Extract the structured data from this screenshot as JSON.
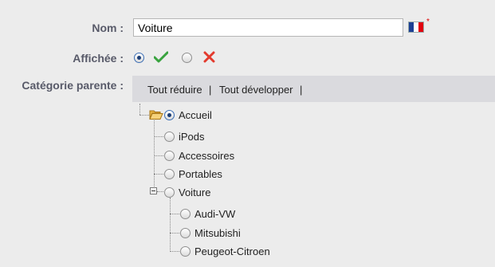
{
  "form": {
    "name_label": "Nom :",
    "name_value": "Voiture",
    "required_mark": "*",
    "displayed_label": "Affichée :",
    "displayed_selected": "yes",
    "parent_category_label": "Catégorie parente :"
  },
  "flag": {
    "colors": [
      "#1c3f94",
      "#ffffff",
      "#e1000f"
    ]
  },
  "icons": {
    "yes": "check-icon",
    "no": "cross-icon",
    "root": "open-folder-icon",
    "collapse": "minus-icon"
  },
  "colors": {
    "check": "#39a33f",
    "cross": "#e33b2e",
    "toolbar_bg": "#dadade",
    "page_bg": "#ececec"
  },
  "tree": {
    "collapse_all": "Tout réduire",
    "expand_all": "Tout développer",
    "separator": "|",
    "root": {
      "label": "Accueil",
      "selected": true
    },
    "children": [
      "iPods",
      "Accessoires",
      "Portables",
      "Voiture"
    ],
    "voiture_children": [
      "Audi-VW",
      "Mitsubishi",
      "Peugeot-Citroen"
    ]
  }
}
